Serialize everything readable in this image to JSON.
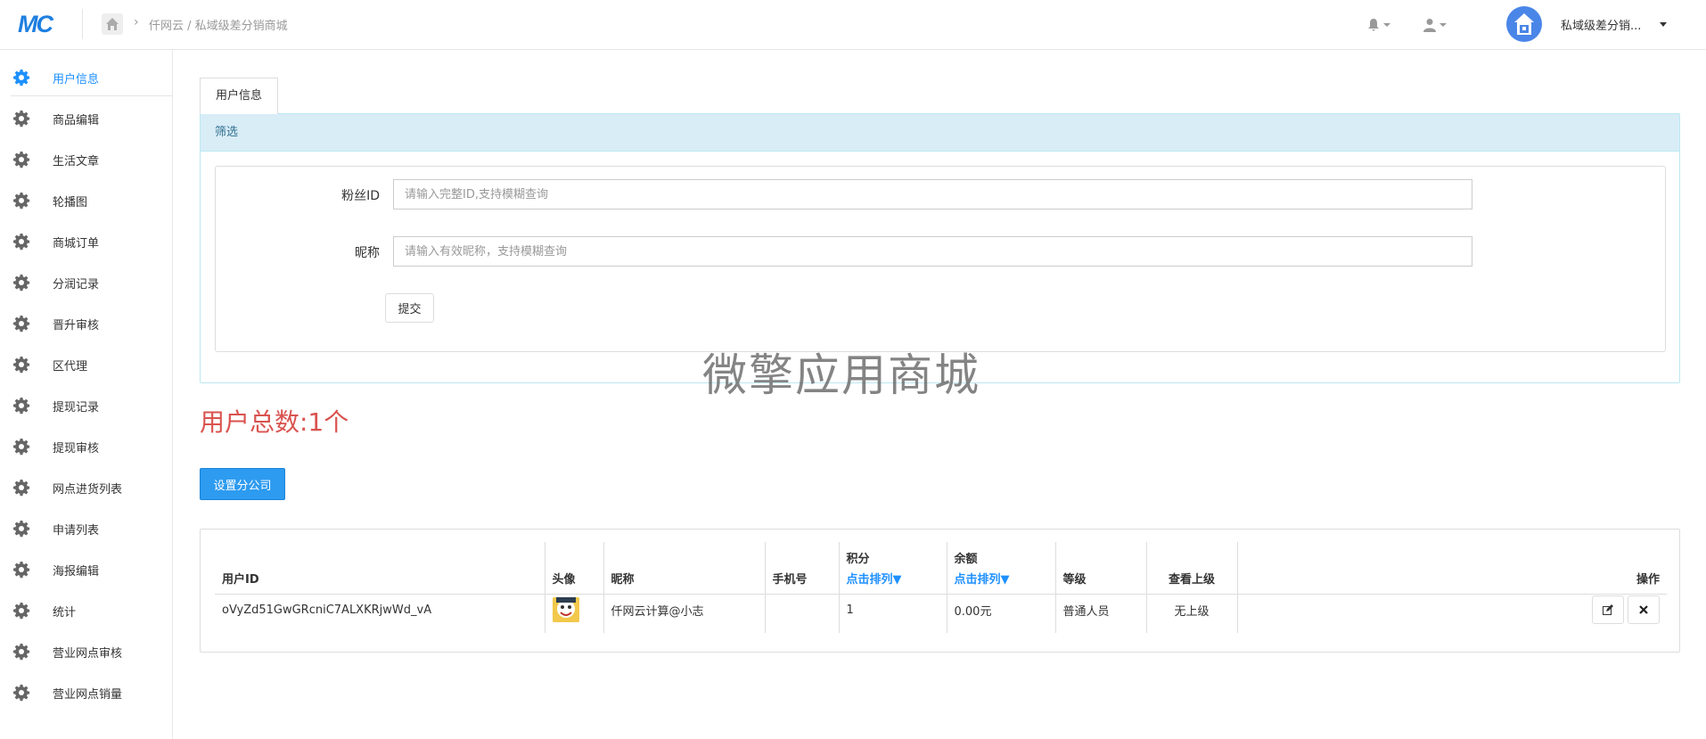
{
  "header": {
    "logo": "MC",
    "breadcrumb": "仟网云 / 私域级差分销商城",
    "store_name": "私域级差分销..."
  },
  "sidebar": {
    "items": [
      {
        "label": "用户信息",
        "active": true
      },
      {
        "label": "商品编辑"
      },
      {
        "label": "生活文章"
      },
      {
        "label": "轮播图"
      },
      {
        "label": "商城订单"
      },
      {
        "label": "分润记录"
      },
      {
        "label": "晋升审核"
      },
      {
        "label": "区代理"
      },
      {
        "label": "提现记录"
      },
      {
        "label": "提现审核"
      },
      {
        "label": "网点进货列表"
      },
      {
        "label": "申请列表"
      },
      {
        "label": "海报编辑"
      },
      {
        "label": "统计"
      },
      {
        "label": "营业网点审核"
      },
      {
        "label": "营业网点销量"
      }
    ]
  },
  "tab": {
    "label": "用户信息"
  },
  "filter": {
    "title": "筛选",
    "fan_id_label": "粉丝ID",
    "fan_id_placeholder": "请输入完整ID,支持模糊查询",
    "nickname_label": "昵称",
    "nickname_placeholder": "请输入有效昵称，支持模糊查询",
    "submit_label": "提交"
  },
  "watermark": "微擎应用商城",
  "total_text": "用户总数:1个",
  "set_branch_button": "设置分公司",
  "table": {
    "headers": {
      "user_id": "用户ID",
      "avatar": "头像",
      "nickname": "昵称",
      "phone": "手机号",
      "points": "积分",
      "balance": "余额",
      "level": "等级",
      "superior": "查看上级",
      "ops": "操作",
      "sort_link": "点击排列▼"
    },
    "rows": [
      {
        "user_id": "oVyZd51GwGRcniC7ALXKRjwWd_vA",
        "nickname": "仟网云计算@小志",
        "phone": "",
        "points": "1",
        "balance": "0.00元",
        "level": "普通人员",
        "superior": "无上级"
      }
    ]
  },
  "colors": {
    "accent": "#1e90ff",
    "danger": "#d9534f",
    "primary_btn": "#2d9bf0",
    "panel_head": "#d9edf7"
  }
}
